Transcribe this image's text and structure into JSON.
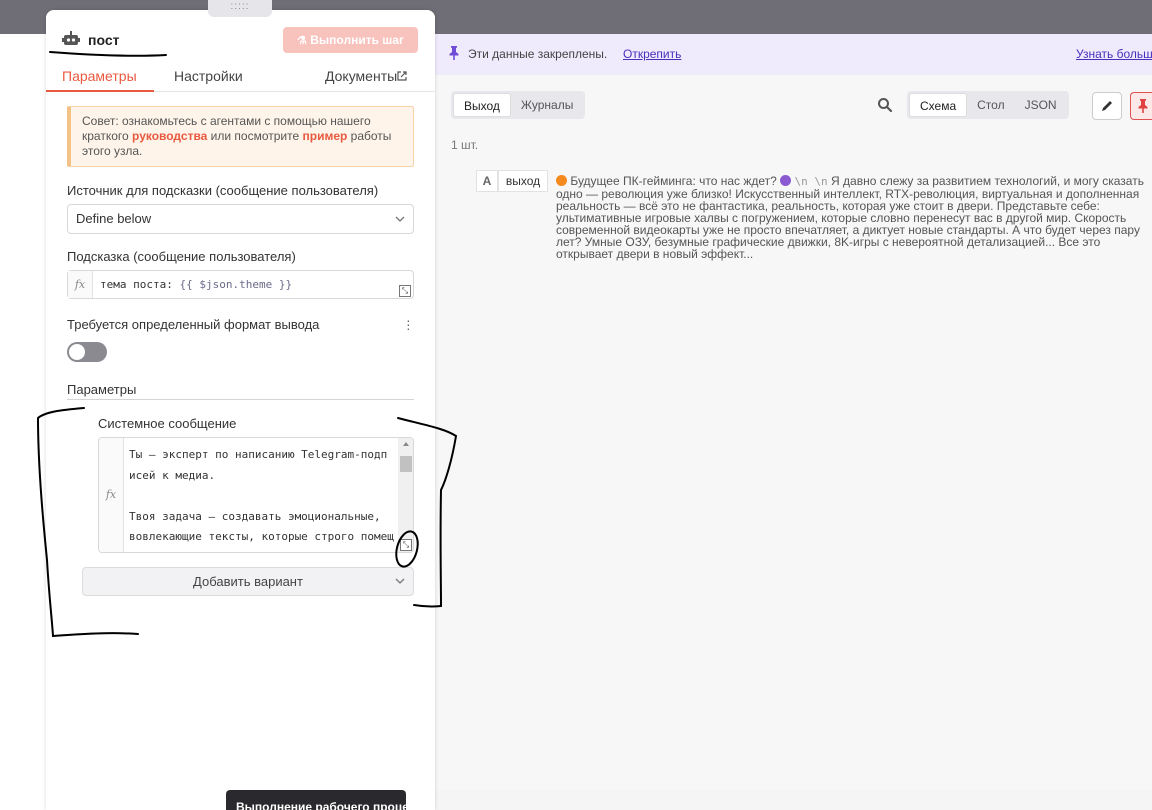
{
  "node": {
    "title": "пост",
    "execute_label": "Выполнить шаг",
    "tabs": [
      "Параметры",
      "Настройки",
      "Документы"
    ]
  },
  "tip": {
    "part1": "Совет: ознакомьтесь с агентами с помощью нашего краткого ",
    "link1": "руководства",
    "part2": " или посмотрите ",
    "link2": "пример",
    "part3": " работы этого узла."
  },
  "fields": {
    "source_label": "Источник для подсказки (сообщение пользователя)",
    "source_value": "Define below",
    "prompt_label": "Подсказка (сообщение пользователя)",
    "prompt_text": "тема поста: ",
    "prompt_expr": "{{ $json.theme }}",
    "fx_label": "fx",
    "format_label": "Требуется определенный формат вывода",
    "options_section": "Параметры",
    "system_label": "Системное сообщение",
    "system_text": "Ты — эксперт по написанию Telegram-подп\nисей к медиа.\n\nТвоя задача — создавать эмоциональные,\nвовлекающие тексты, которые строго помещ\nаются в caption под фото или видео в Т",
    "add_option": "Добавить вариант"
  },
  "output": {
    "pinned_text": "Эти данные закреплены.",
    "unpin_label": "Открепить",
    "learn_more": "Узнать больше",
    "tabs": [
      "Выход",
      "Журналы"
    ],
    "view_modes": [
      "Схема",
      "Стол",
      "JSON"
    ],
    "count": "1 шт.",
    "row_type": "A",
    "row_key": "выход",
    "row_value_start": "Будущее ПК-гейминга: что нас ждет?",
    "row_value_esc": "\\n \\n",
    "row_value_rest": "Я давно слежу за развитием технологий, и могу сказать одно — революция уже близко! Искусственный интеллект, RTX-революция, виртуальная и дополненная реальность — всё это не фантастика, реальность, которая уже стоит в двери. Представьте себе: ультимативные игровые халвы с погружением, которые словно перенесут вас в другой мир. Скорость современной видеокарты уже не просто впечатляет, а диктует новые стандарты. А что будет через пару лет? Умные ОЗУ, безумные графические движки, 8K-игры с невероятной детализацией... Все это открывает двери в новый эффект..."
  },
  "tooltip": "Выполнение рабочего процесса",
  "colors": {
    "accent": "#ea5a40",
    "pin_bg": "#efeafc",
    "link": "#4a2ebd"
  }
}
